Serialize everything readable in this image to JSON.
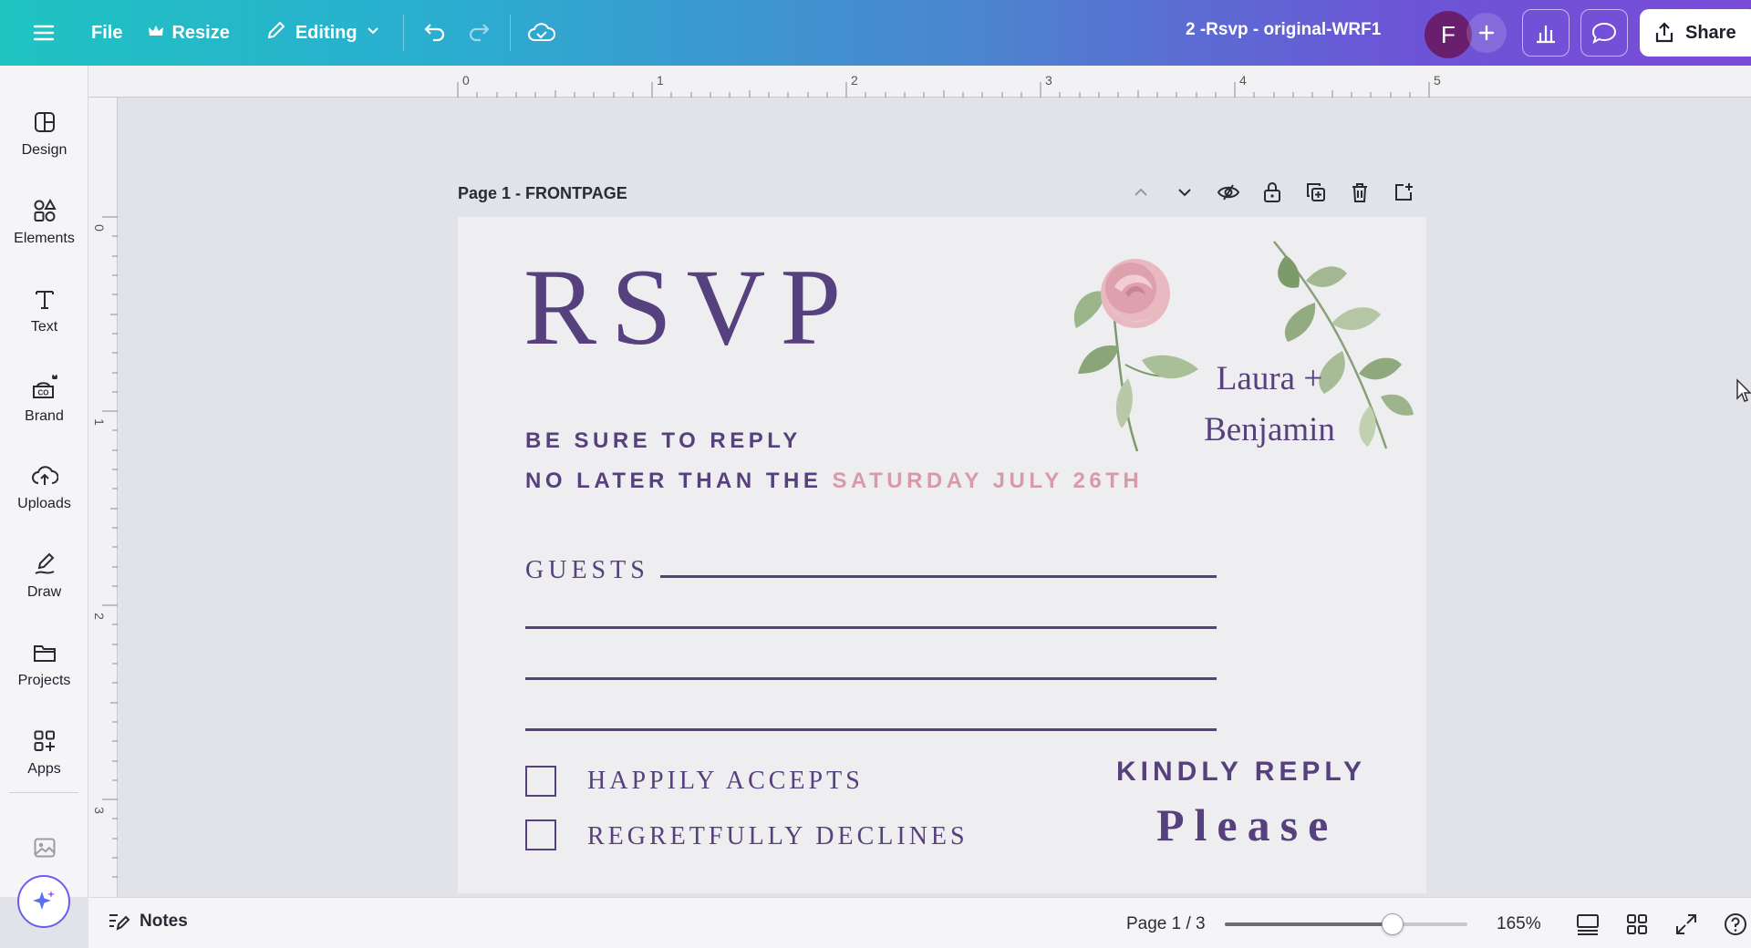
{
  "topbar": {
    "file_label": "File",
    "resize_label": "Resize",
    "editing_label": "Editing",
    "doc_title": "2 -Rsvp - original-WRF1",
    "avatar_initial": "F",
    "share_label": "Share",
    "gradient": [
      "#1fc3c1",
      "#7a4bd8"
    ]
  },
  "sidebar": {
    "items": [
      {
        "label": "Design",
        "icon": "design-icon"
      },
      {
        "label": "Elements",
        "icon": "elements-icon"
      },
      {
        "label": "Text",
        "icon": "text-icon"
      },
      {
        "label": "Brand",
        "icon": "brand-icon"
      },
      {
        "label": "Uploads",
        "icon": "uploads-icon"
      },
      {
        "label": "Draw",
        "icon": "draw-icon"
      },
      {
        "label": "Projects",
        "icon": "projects-icon"
      },
      {
        "label": "Apps",
        "icon": "apps-icon"
      }
    ]
  },
  "ruler": {
    "top": [
      "0",
      "1",
      "2",
      "3",
      "4",
      "5"
    ],
    "left": [
      "0",
      "1",
      "2",
      "3"
    ]
  },
  "page": {
    "label": "Page 1 - FRONTPAGE"
  },
  "card": {
    "title": "RSVP",
    "reply_line1": "BE SURE TO REPLY",
    "reply_line2_prefix": "NO LATER THAN THE ",
    "reply_date": "SATURDAY JULY 26TH",
    "names_line1": "Laura +",
    "names_line2": "Benjamin",
    "guests_label": "GUESTS",
    "accept_label": "HAPPILY ACCEPTS",
    "decline_label": "REGRETFULLY DECLINES",
    "kindly_label": "KINDLY REPLY",
    "please_label": "Please",
    "colors": {
      "text": "#57407e",
      "accent": "#d79aa8",
      "background": "#eeeef0"
    }
  },
  "bottombar": {
    "notes_label": "Notes",
    "page_count": "Page 1 / 3",
    "zoom_value": "165%",
    "zoom_fraction": 0.69
  }
}
